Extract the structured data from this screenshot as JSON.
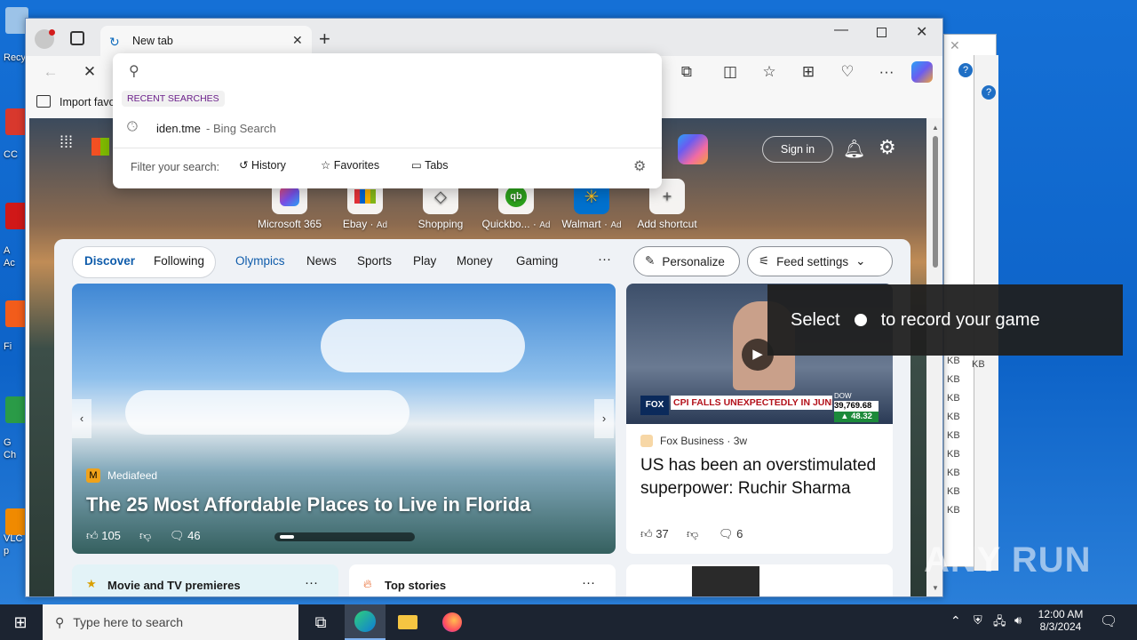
{
  "desktop": {
    "icons": [
      {
        "label": "Recy",
        "color": "#9cc3e8"
      },
      {
        "label": "CC",
        "color": "#d8382d"
      },
      {
        "label": "A",
        "color": "#d01818"
      },
      {
        "label": "Fi",
        "color": "#f25c1b"
      },
      {
        "label": "G",
        "color": "#2a9b47"
      },
      {
        "label": "VLC",
        "color": "#f08a00"
      }
    ],
    "icon_sublabels": [
      "",
      "",
      "Ac",
      "",
      "Ch",
      "p"
    ]
  },
  "background_window": {
    "sizes": [
      "KB",
      "KB",
      "KB",
      "KB",
      "KB",
      "KB",
      "KB",
      "KB",
      "KB"
    ],
    "side_kb": "KB"
  },
  "browser": {
    "tab_title": "New tab",
    "favorites_import": "Import favo",
    "address": {
      "placeholder": "",
      "recent_header": "RECENT SEARCHES",
      "recent_item": "iden.tme",
      "recent_item_source": " - Bing Search",
      "filter_label": "Filter your search:",
      "filter_options": [
        "History",
        "Favorites",
        "Tabs"
      ]
    },
    "toolbar_icons": [
      "extensions-icon",
      "split-screen-icon",
      "favorites-icon",
      "collections-icon",
      "browser-essentials-icon",
      "more-icon",
      "copilot-icon"
    ]
  },
  "ntp": {
    "sign_in": "Sign in",
    "shortcuts": [
      {
        "label": "Microsoft 365",
        "ad": "",
        "icon": "m365-icon"
      },
      {
        "label": "Ebay",
        "ad": "Ad",
        "icon": "ebay-icon"
      },
      {
        "label": "Shopping",
        "ad": "",
        "icon": "shopping-tag-icon"
      },
      {
        "label": "Quickbo...",
        "ad": "Ad",
        "icon": "quickbooks-icon"
      },
      {
        "label": "Walmart",
        "ad": "Ad",
        "icon": "walmart-icon"
      },
      {
        "label": "Add shortcut",
        "ad": "",
        "icon": "plus-icon"
      }
    ],
    "tabs": {
      "discover": "Discover",
      "following": "Following"
    },
    "categories": [
      "Olympics",
      "News",
      "Sports",
      "Play",
      "Money",
      "Gaming"
    ],
    "personalize": "Personalize",
    "feed_settings": "Feed settings",
    "hero": {
      "source": "Mediafeed",
      "title": "The 25 Most Affordable Places to Live in Florida",
      "likes": "105",
      "comments": "46"
    },
    "side_card": {
      "ticker_headline": "CPI FALLS UNEXPECTEDLY IN JUNE",
      "ticker_dow": "39,769.68",
      "ticker_change": "▲ 48.32",
      "ticker_label": "DOW",
      "network": "FOX",
      "source": "Fox Business",
      "age": "3w",
      "title": "US has been an overstimulated superpower: Ruchir Sharma",
      "likes": "37",
      "comments": "6"
    },
    "bottom_cards": [
      {
        "label": "Movie and TV premieres"
      },
      {
        "label": "Top stories"
      }
    ],
    "bottom_more": "···"
  },
  "gamebar": {
    "select": "Select",
    "rest": "to record your game"
  },
  "taskbar": {
    "search_placeholder": "Type here to search",
    "time": "12:00 AM",
    "date": "8/3/2024"
  },
  "watermark": "ANY RUN"
}
